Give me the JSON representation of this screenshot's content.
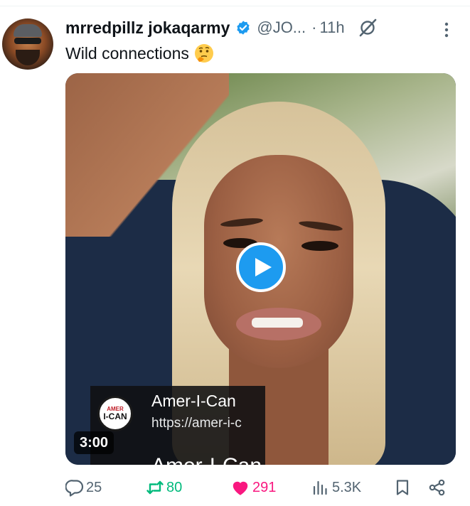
{
  "post": {
    "author": {
      "display_name": "mrredpillz jokaqarmy",
      "handle": "@JO...",
      "verified": true,
      "avatar_icon": "avatar-photo"
    },
    "separator": "·",
    "timestamp": "11h",
    "text": "Wild connections",
    "text_emoji": "thinking-face-emoji",
    "media": {
      "type": "video",
      "duration": "3:00",
      "link_card": {
        "title": "Amer-I-Can",
        "url": "https://amer-i-c",
        "logo_top": "AMER",
        "logo_bottom": "I-CAN",
        "peek_text": "Amer-I-Can"
      }
    },
    "actions": {
      "replies": "25",
      "reposts": "80",
      "likes": "291",
      "views": "5.3K",
      "liked": true
    }
  },
  "colors": {
    "accent": "#1d9bf0",
    "repost": "#00ba7c",
    "like": "#f91880",
    "muted": "#536471"
  }
}
